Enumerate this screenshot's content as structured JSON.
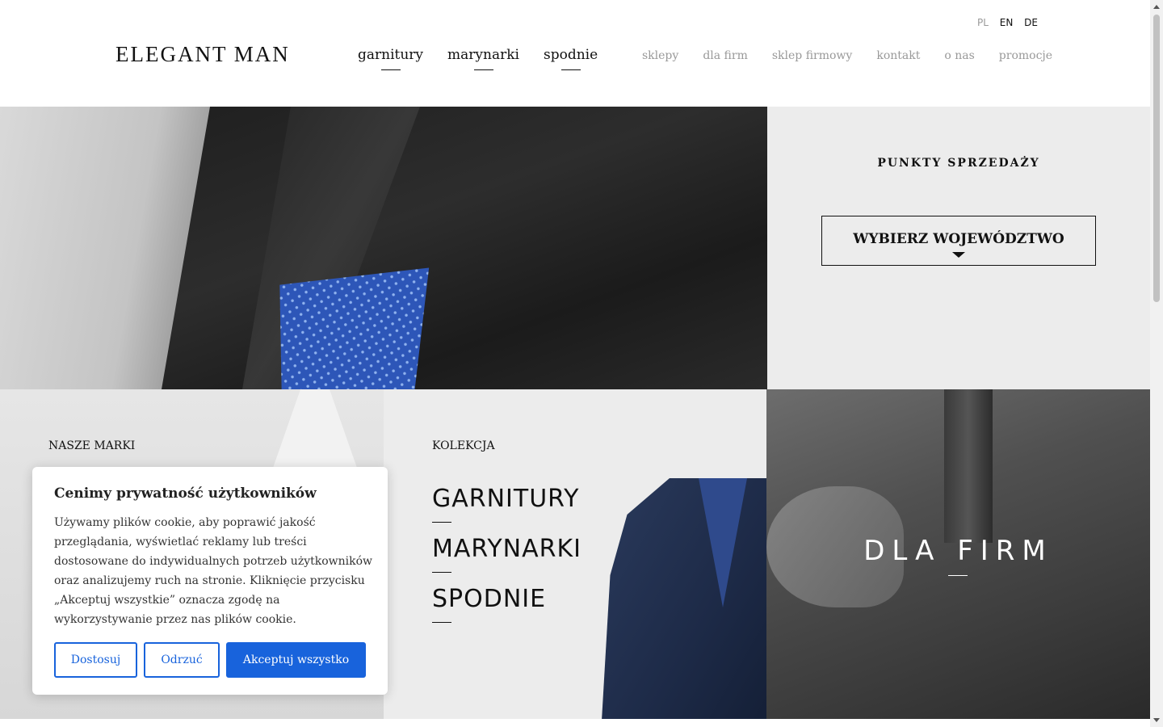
{
  "brand": {
    "logo": "ELEGANT MAN"
  },
  "languages": [
    {
      "label": "PL",
      "active": false
    },
    {
      "label": "EN",
      "active": true
    },
    {
      "label": "DE",
      "active": true
    }
  ],
  "main_nav": [
    {
      "label": "garnitury"
    },
    {
      "label": "marynarki"
    },
    {
      "label": "spodnie"
    }
  ],
  "secondary_nav": [
    {
      "label": "sklepy"
    },
    {
      "label": "dla firm"
    },
    {
      "label": "sklep firmowy"
    },
    {
      "label": "kontakt"
    },
    {
      "label": "o nas"
    },
    {
      "label": "promocje"
    }
  ],
  "shops": {
    "title": "PUNKTY SPRZEDAŻY",
    "select_label": "WYBIERZ WOJEWÓDZTWO"
  },
  "brands": {
    "title": "NASZE MARKI"
  },
  "collection": {
    "title": "KOLEKCJA",
    "links": [
      "GARNITURY",
      "MARYNARKI",
      "SPODNIE"
    ]
  },
  "firms": {
    "title": "DLA FIRM"
  },
  "cookie": {
    "title": "Cenimy prywatność użytkowników",
    "text": "Używamy plików cookie, aby poprawić jakość przeglądania, wyświetlać reklamy lub treści dostosowane do indywidualnych potrzeb użytkowników oraz analizujemy ruch na stronie. Kliknięcie przycisku „Akceptuj wszystkie” oznacza zgodę na wykorzystywanie przez nas plików cookie.",
    "customize_label": "Dostosuj",
    "reject_label": "Odrzuć",
    "accept_label": "Akceptuj wszystko"
  },
  "colors": {
    "accent": "#1863dc",
    "pocket_square": "#2d56b8",
    "suit": "#1d2a47"
  }
}
